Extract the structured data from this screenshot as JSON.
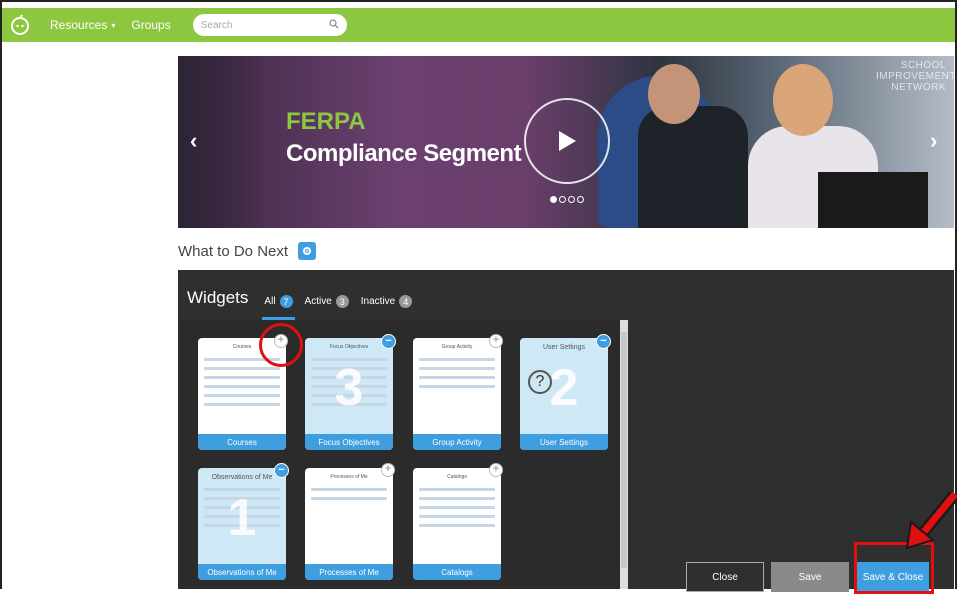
{
  "nav": {
    "resources_label": "Resources",
    "groups_label": "Groups",
    "search_placeholder": "Search"
  },
  "hero": {
    "title_line1": "FERPA",
    "title_line2": "Compliance Segment",
    "brand_line1": "SCHOOL",
    "brand_line2": "IMPROVEMENT",
    "brand_line3": "NETWORK"
  },
  "next": {
    "heading": "What to Do Next"
  },
  "widgets_panel": {
    "title": "Widgets",
    "tabs": [
      {
        "label": "All",
        "count": "7"
      },
      {
        "label": "Active",
        "count": "3"
      },
      {
        "label": "Inactive",
        "count": "4"
      }
    ]
  },
  "widgets": [
    {
      "title": "Courses",
      "footer": "Courses",
      "number": ""
    },
    {
      "title": "Focus Objectives",
      "footer": "Focus Objectives",
      "number": "3"
    },
    {
      "title": "Group Activity",
      "footer": "Group Activity",
      "number": ""
    },
    {
      "title": "User Settings",
      "footer": "User Settings",
      "number": "2"
    },
    {
      "title": "Observations of Me",
      "footer": "Observations of Me",
      "number": "1"
    },
    {
      "title": "Processes of Me",
      "footer": "Processes of Me",
      "number": ""
    },
    {
      "title": "Catalogs",
      "footer": "Catalogs",
      "number": ""
    }
  ],
  "buttons": {
    "close": "Close",
    "save": "Save",
    "save_close": "Save & Close"
  },
  "colors": {
    "nav_green": "#8dc63f",
    "accent_blue": "#3e9ee0",
    "highlight_red": "#e01010"
  }
}
